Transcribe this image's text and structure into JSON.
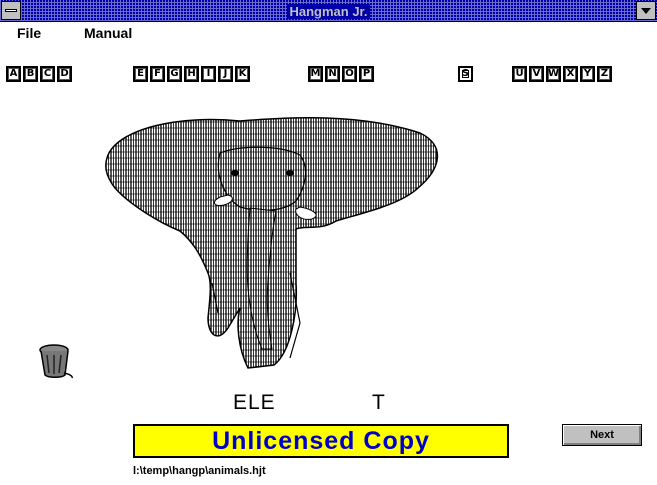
{
  "window": {
    "title": "Hangman Jr."
  },
  "menu": [
    "File",
    "Manual"
  ],
  "letters": [
    {
      "ch": "A"
    },
    {
      "ch": "B"
    },
    {
      "ch": "C"
    },
    {
      "ch": "D"
    },
    {
      "ch": "E"
    },
    {
      "ch": "F"
    },
    {
      "ch": "G"
    },
    {
      "ch": "H"
    },
    {
      "ch": "I"
    },
    {
      "ch": "J"
    },
    {
      "ch": "K"
    },
    {
      "ch": "M"
    },
    {
      "ch": "N"
    },
    {
      "ch": "O"
    },
    {
      "ch": "P"
    },
    {
      "ch": "S"
    },
    {
      "ch": "U"
    },
    {
      "ch": "V"
    },
    {
      "ch": "W"
    },
    {
      "ch": "X"
    },
    {
      "ch": "Y"
    },
    {
      "ch": "Z"
    }
  ],
  "game": {
    "word_part1": "ELE",
    "word_part2": "T"
  },
  "banner": {
    "text": "Unlicensed Copy",
    "bg_color": "#ffff00",
    "text_color": "#0000c8"
  },
  "next_button": "Next",
  "file_path": "l:\\temp\\hangp\\animals.hjt",
  "icons": {
    "trash": "trash-can-icon",
    "picture": "elephant-picture"
  }
}
